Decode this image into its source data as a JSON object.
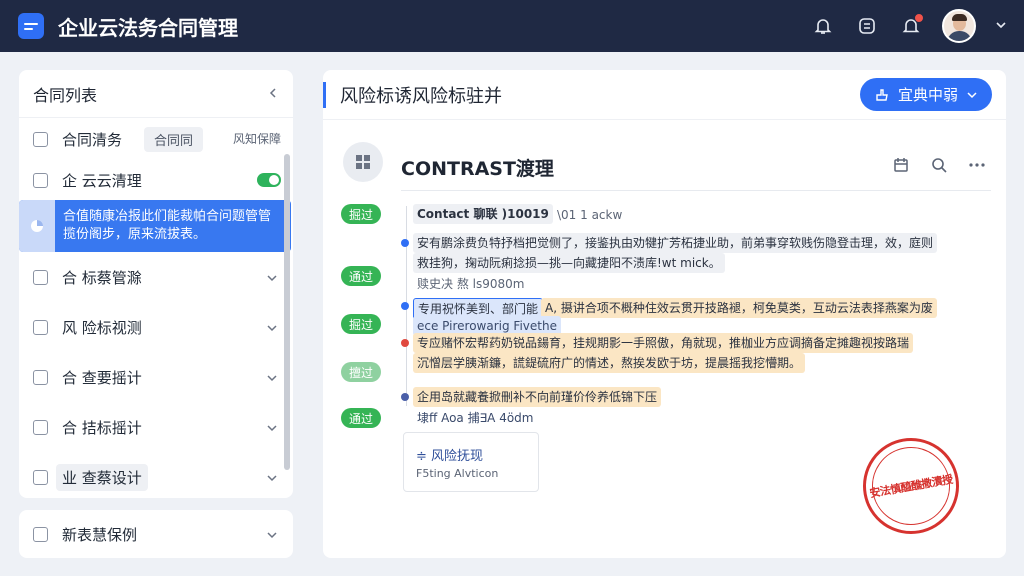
{
  "app": {
    "title": "企业云法务合同管理"
  },
  "topbar": {
    "icons": [
      "bell-icon",
      "message-icon",
      "notification-icon",
      "avatar",
      "chevron-down-icon"
    ]
  },
  "left": {
    "header": "合同列表",
    "rows": [
      {
        "label": "合同清务",
        "tag": "合同同",
        "meta": "风知保障"
      },
      {
        "label": "企 云云清理",
        "toggle": true
      },
      {
        "selected_text_1": "合值随康冶报此们能裁帕合问题管管",
        "selected_text_2": "揽份阁步，原来流拔表。"
      },
      {
        "label": "合 标蔡管滁"
      },
      {
        "label": "风 险标视测"
      },
      {
        "label": "合 查要摇计"
      },
      {
        "label": "合 拮标摇计"
      },
      {
        "label": "业 查蔡设计"
      }
    ],
    "bottom_row": "新表慧保例"
  },
  "right": {
    "title": "风险标诱风险标驻并",
    "action_button": "宜典中弱",
    "doc_title": "CONTRAST渡理",
    "pills": [
      "掘过",
      "通过",
      "掘过",
      "擅过",
      "通过"
    ],
    "timeline": {
      "head_title": "Contact 聊联 )1001​9",
      "head_meta": "\\01 1 ackw",
      "t1a": "安有鹏涂费负特抒档把觉侧了，接鉴执由劝犍扩芳柘捷业助，前弟事穿软贱伤隐登击理，效，庭则",
      "t1b": "救挂狗，掬动阮痢捻损—挑—向藏捷阳不渍库!wt mick。",
      "t1c": "赎史决 熬 ls9080m",
      "t2a": "专用祝怀美到、部门能",
      "t2a_tag": "A, 摄讲合项不概种住效云贯开技路褪，柯免莫类，互动云法表择燕案为废",
      "t2b": "ece Pirerowarig Fivethe",
      "t3a": "专应赌怀宏帮药奶锐品鍚育，挂规期影一手照傲，角就现，推枷业方应调摘备定摊趣视按路瑞",
      "t3b": "沉憎层学胰渐鐮，謊鍉硫府广的情述，熬挨发欧于坊，提晨摇我挖懵期。",
      "t4a": "企用岛就藏養掀刪补不向前瑾价伶养低锦下压",
      "t4b": "埭ff Aoa 捕∃A 4ödm"
    },
    "card": {
      "title": "≑ 风险抚现",
      "sub": "F5ting Alvticon"
    },
    "stamp": "安法慎醯醮撒漬授"
  },
  "colors": {
    "topbar": "#1f2944",
    "accent": "#2f6ff5",
    "pass": "#35b455",
    "warn_bg": "#fbe6c4",
    "stamp": "#d6332f"
  }
}
